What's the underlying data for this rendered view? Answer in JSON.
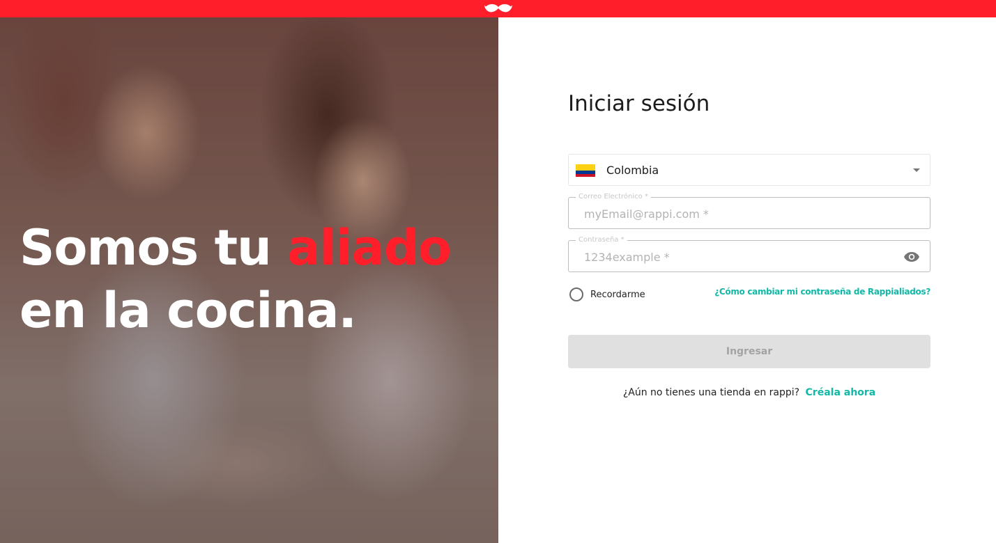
{
  "brand": {
    "logo_icon": "mustache-logo-icon",
    "primary_color": "#ff1e2a",
    "link_color": "#14b8a6"
  },
  "hero": {
    "title_part1": "Somos tu ",
    "title_accent": "aliado",
    "title_line2": "en la cocina."
  },
  "login": {
    "title": "Iniciar sesión",
    "country": {
      "selected": "Colombia",
      "flag_icon": "colombia-flag-icon"
    },
    "email": {
      "label": "Correo Electrónico *",
      "placeholder": "myEmail@rappi.com *",
      "value": ""
    },
    "password": {
      "label": "Contraseña *",
      "placeholder": "1234example *",
      "value": "",
      "toggle_icon": "eye-icon"
    },
    "remember_label": "Recordarme",
    "forgot_link": "¿Cómo cambiar mi contraseña de Rappialiados?",
    "submit_label": "Ingresar",
    "signup_prompt": "¿Aún no tienes una tienda en rappi?",
    "signup_cta": "Créala ahora"
  }
}
